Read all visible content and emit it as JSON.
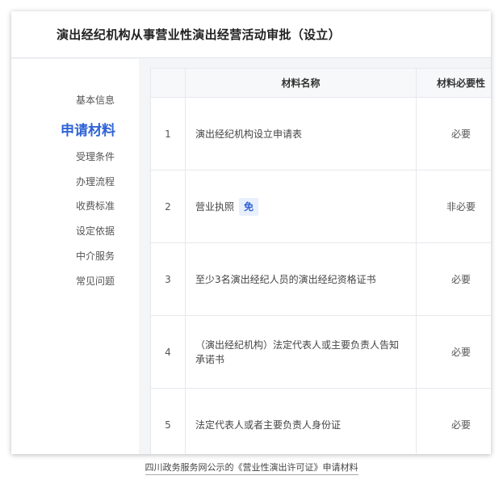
{
  "header": {
    "title": "演出经纪机构从事营业性演出经营活动审批（设立）"
  },
  "sidebar": {
    "items": [
      {
        "label": "基本信息",
        "active": false
      },
      {
        "label": "申请材料",
        "active": true
      },
      {
        "label": "受理条件",
        "active": false
      },
      {
        "label": "办理流程",
        "active": false
      },
      {
        "label": "收费标准",
        "active": false
      },
      {
        "label": "设定依据",
        "active": false
      },
      {
        "label": "中介服务",
        "active": false
      },
      {
        "label": "常见问题",
        "active": false
      }
    ]
  },
  "table": {
    "headers": {
      "index": "",
      "name": "材料名称",
      "required": "材料必要性"
    },
    "rows": [
      {
        "index": "1",
        "name": "演出经纪机构设立申请表",
        "badge": "",
        "required": "必要"
      },
      {
        "index": "2",
        "name": "营业执照",
        "badge": "免",
        "required": "非必要"
      },
      {
        "index": "3",
        "name": "至少3名演出经纪人员的演出经纪资格证书",
        "badge": "",
        "required": "必要"
      },
      {
        "index": "4",
        "name": "（演出经纪机构）法定代表人或主要负责人告知承诺书",
        "badge": "",
        "required": "必要"
      },
      {
        "index": "5",
        "name": "法定代表人或者主要负责人身份证",
        "badge": "",
        "required": "必要"
      }
    ]
  },
  "caption": "四川政务服务网公示的《营业性演出许可证》申请材料",
  "colors": {
    "accent": "#2f63d6",
    "badge_bg": "#e8effd"
  }
}
